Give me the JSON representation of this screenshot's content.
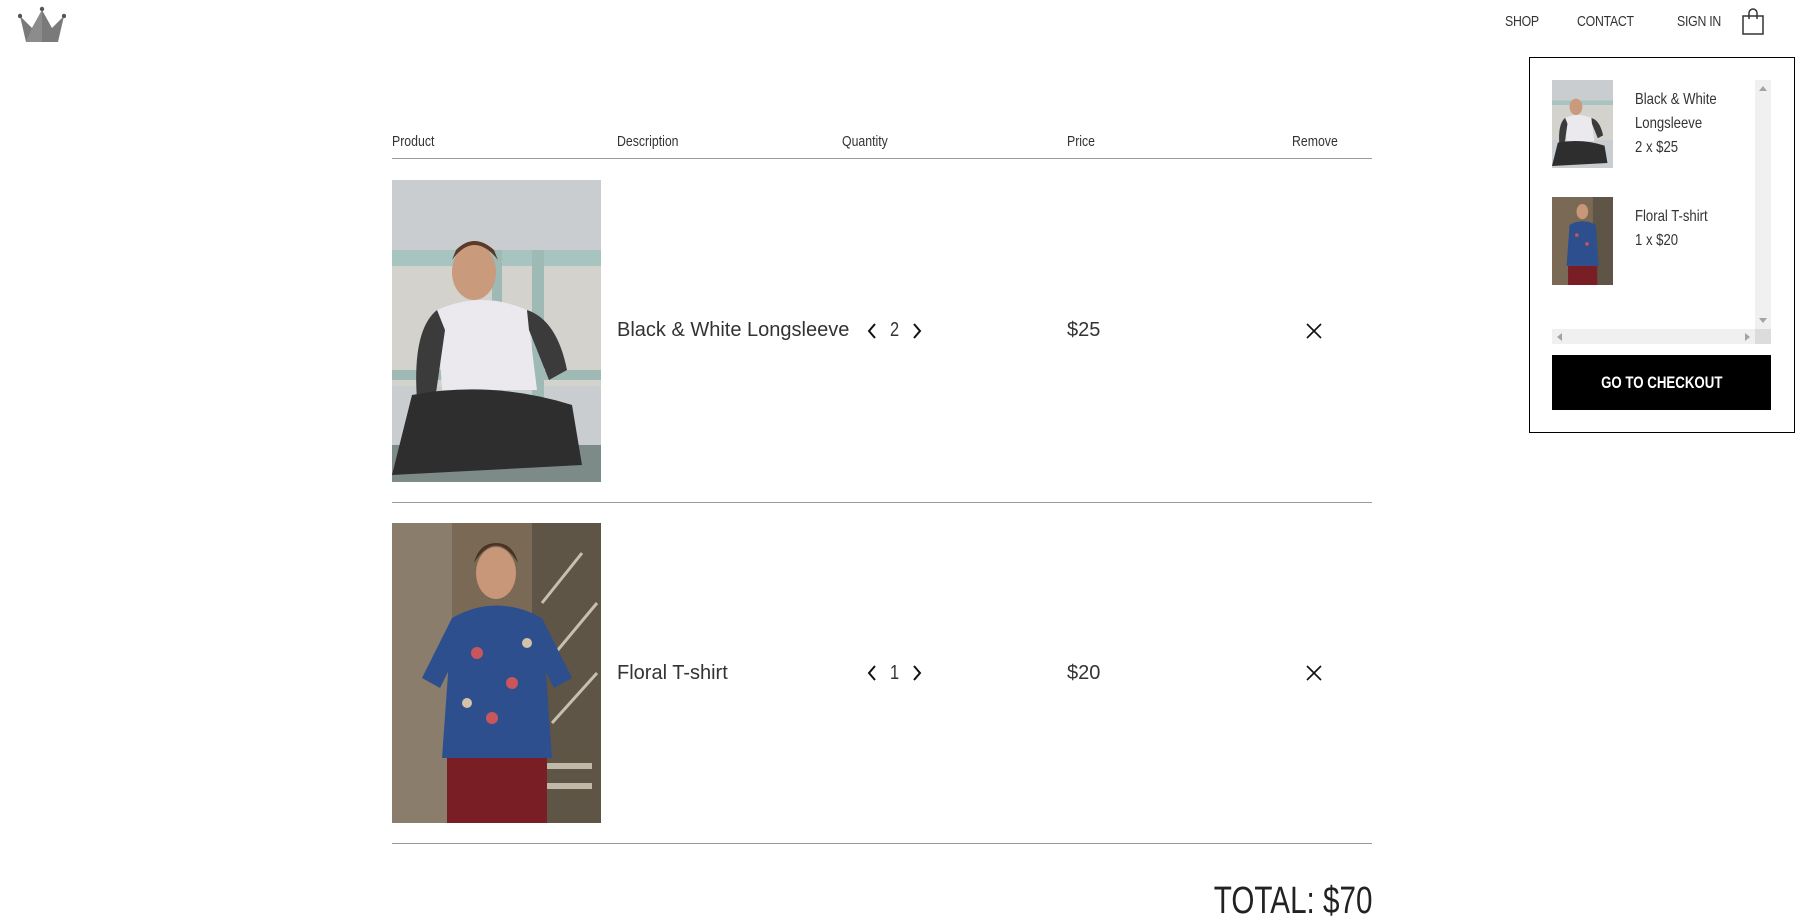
{
  "nav": {
    "links": [
      "SHOP",
      "CONTACT",
      "SIGN IN"
    ]
  },
  "cart": {
    "headers": {
      "product": "Product",
      "description": "Description",
      "quantity": "Quantity",
      "price": "Price",
      "remove": "Remove"
    },
    "items": [
      {
        "description": "Black & White Longsleeve",
        "quantity": "2",
        "price": "$25"
      },
      {
        "description": "Floral T-shirt",
        "quantity": "1",
        "price": "$20"
      }
    ],
    "total": "TOTAL: $70"
  },
  "mini_cart": {
    "items": [
      {
        "name": "Black & White Longsleeve",
        "line": "2 x $25"
      },
      {
        "name": "Floral T-shirt",
        "line": "1 x $20"
      }
    ],
    "checkout_label": "GO TO CHECKOUT"
  },
  "icons": {
    "logo": "crown-icon",
    "bag": "shopping-bag-icon",
    "decrease": "chevron-left-icon",
    "increase": "chevron-right-icon",
    "remove": "close-icon"
  }
}
